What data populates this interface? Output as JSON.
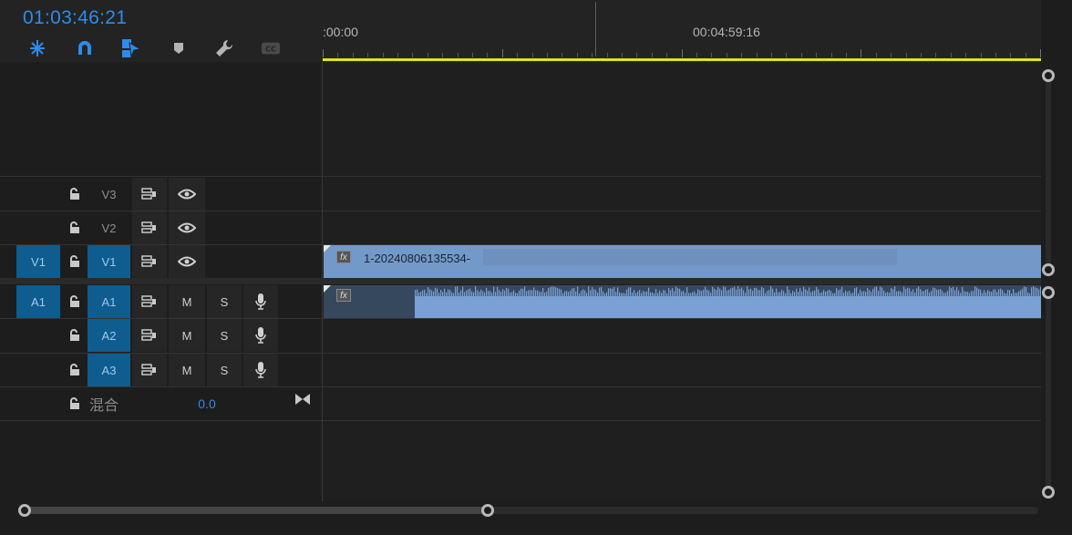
{
  "timeline": {
    "timecode": "01:03:46:21",
    "ruler_labels": [
      ":00:00",
      "00:04:59:16"
    ],
    "video_clip": {
      "name": "1-20240806135534-",
      "fx_label": "fx"
    },
    "audio_clip": {
      "fx_label": "fx"
    }
  },
  "toolbar": [
    {
      "name": "insert-overwrite-icon"
    },
    {
      "name": "snap-magnet-icon"
    },
    {
      "name": "linked-selection-icon"
    },
    {
      "name": "add-marker-icon"
    },
    {
      "name": "timeline-settings-wrench-icon"
    },
    {
      "name": "captions-cc-icon"
    }
  ],
  "video_tracks": [
    {
      "id": "V3",
      "source": "",
      "label": "V3"
    },
    {
      "id": "V2",
      "source": "",
      "label": "V2"
    },
    {
      "id": "V1",
      "source": "V1",
      "label": "V1"
    }
  ],
  "audio_tracks": [
    {
      "id": "A1",
      "source": "A1",
      "label": "A1",
      "mute": "M",
      "solo": "S"
    },
    {
      "id": "A2",
      "source": "",
      "label": "A2",
      "mute": "M",
      "solo": "S"
    },
    {
      "id": "A3",
      "source": "",
      "label": "A3",
      "mute": "M",
      "solo": "S"
    }
  ],
  "mix": {
    "label": "混合",
    "value": "0.0"
  },
  "colors": {
    "accent": "#2d8ceb",
    "target": "#0f5c8f",
    "video_clip": "#7399c9",
    "audio_clip": "#36485e",
    "work_area": "#e3e31a"
  }
}
